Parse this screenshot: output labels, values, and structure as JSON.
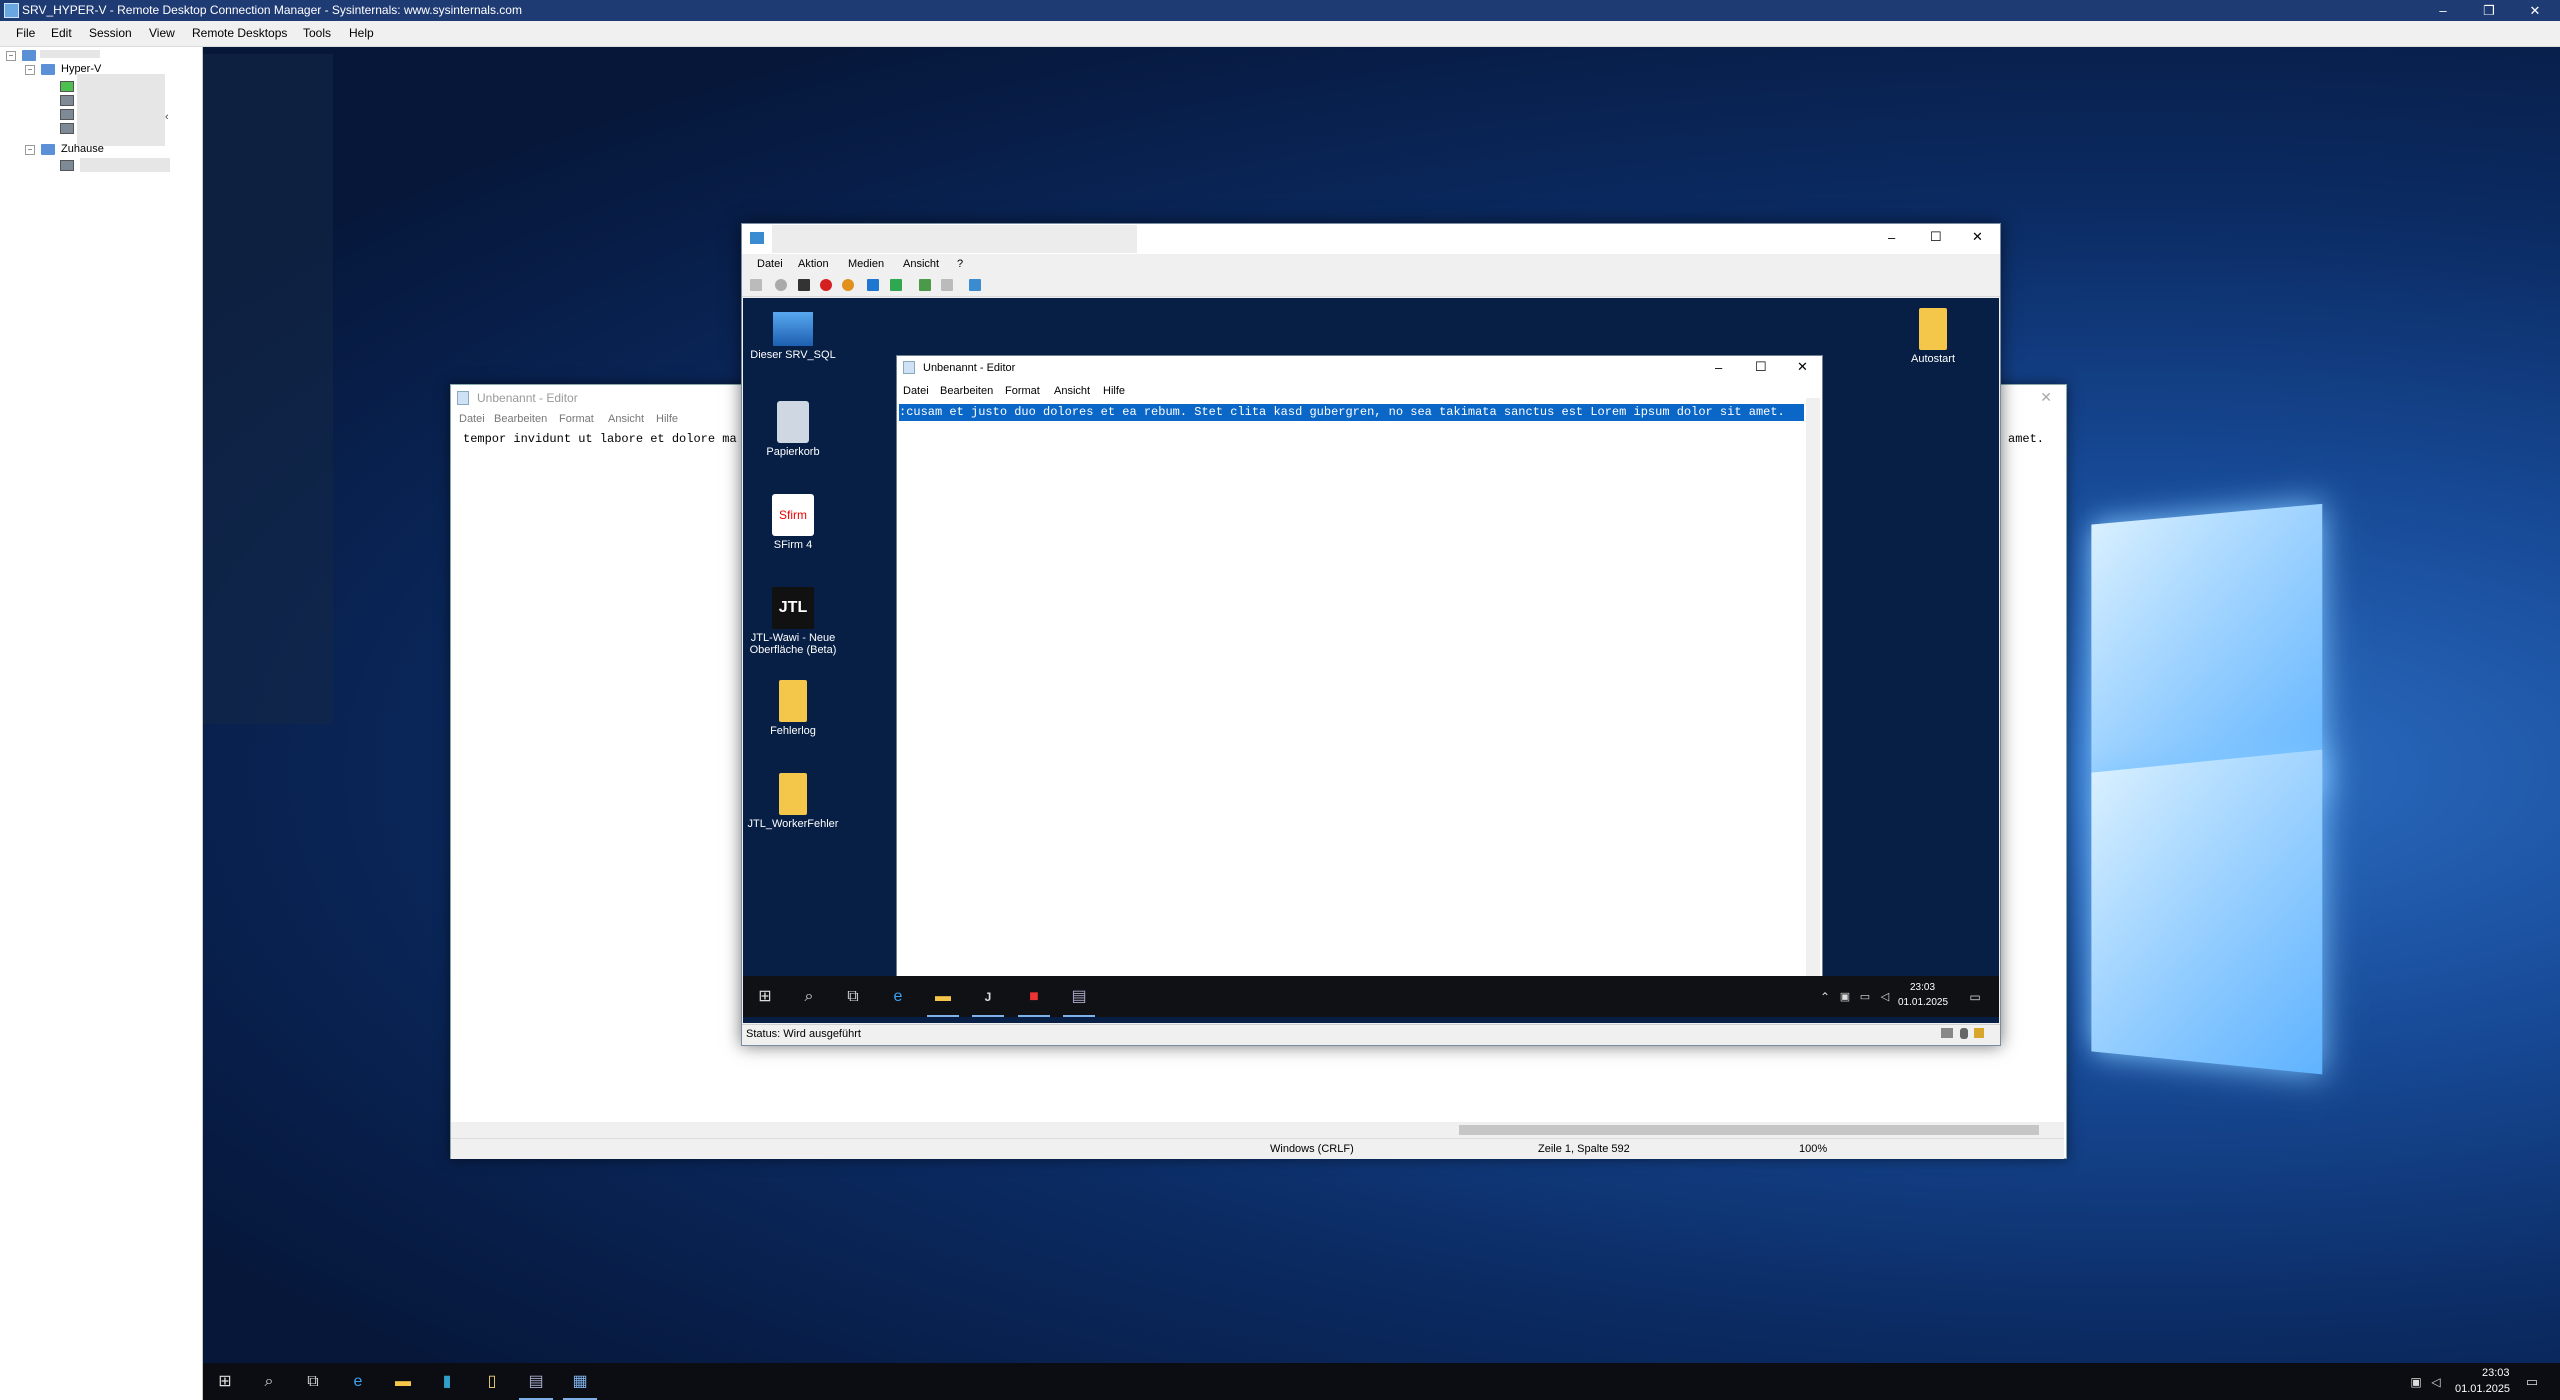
{
  "window": {
    "title": "SRV_HYPER-V - Remote Desktop Connection Manager - Sysinternals: www.sysinternals.com",
    "minimize": "–",
    "restore": "❐",
    "close": "✕"
  },
  "menu": [
    "File",
    "Edit",
    "Session",
    "View",
    "Remote Desktops",
    "Tools",
    "Help"
  ],
  "tree": {
    "group1": "Hyper-V",
    "group2": "Zuhause",
    "collapse_marker": "‹"
  },
  "bg_notepad": {
    "title": "Unbenannt - Editor",
    "menu": [
      "Datei",
      "Bearbeiten",
      "Format",
      "Ansicht",
      "Hilfe"
    ],
    "text_left": "tempor invidunt ut labore et dolore ma",
    "text_right": "amet.",
    "status_encoding": "Windows (CRLF)",
    "status_position": "Zeile 1, Spalte 592",
    "status_zoom": "100%"
  },
  "hyperv": {
    "menu": [
      "Datei",
      "Aktion",
      "Medien",
      "Ansicht",
      "?"
    ],
    "status": "Status: Wird ausgeführt",
    "desktop_icons": [
      "Dieser SRV_SQL",
      "Papierkorb",
      "SFirm 4",
      "JTL-Wawi - Neue Oberfläche (Beta)",
      "Fehlerlog",
      "JTL_WorkerFehler"
    ],
    "autostart_icon": "Autostart",
    "sfirm_logo": "Sfirm",
    "jtl_logo": "JTL",
    "notepad": {
      "title": "Unbenannt - Editor",
      "menu": [
        "Datei",
        "Bearbeiten",
        "Format",
        "Ansicht",
        "Hilfe"
      ],
      "selected_text": ":cusam et justo duo dolores et ea rebum. Stet clita kasd gubergren, no sea takimata sanctus est Lorem ipsum dolor sit amet."
    },
    "taskbar": {
      "time": "23:03",
      "date": "01.01.2025"
    }
  },
  "host_taskbar": {
    "time": "23:03",
    "date": "01.01.2025"
  }
}
